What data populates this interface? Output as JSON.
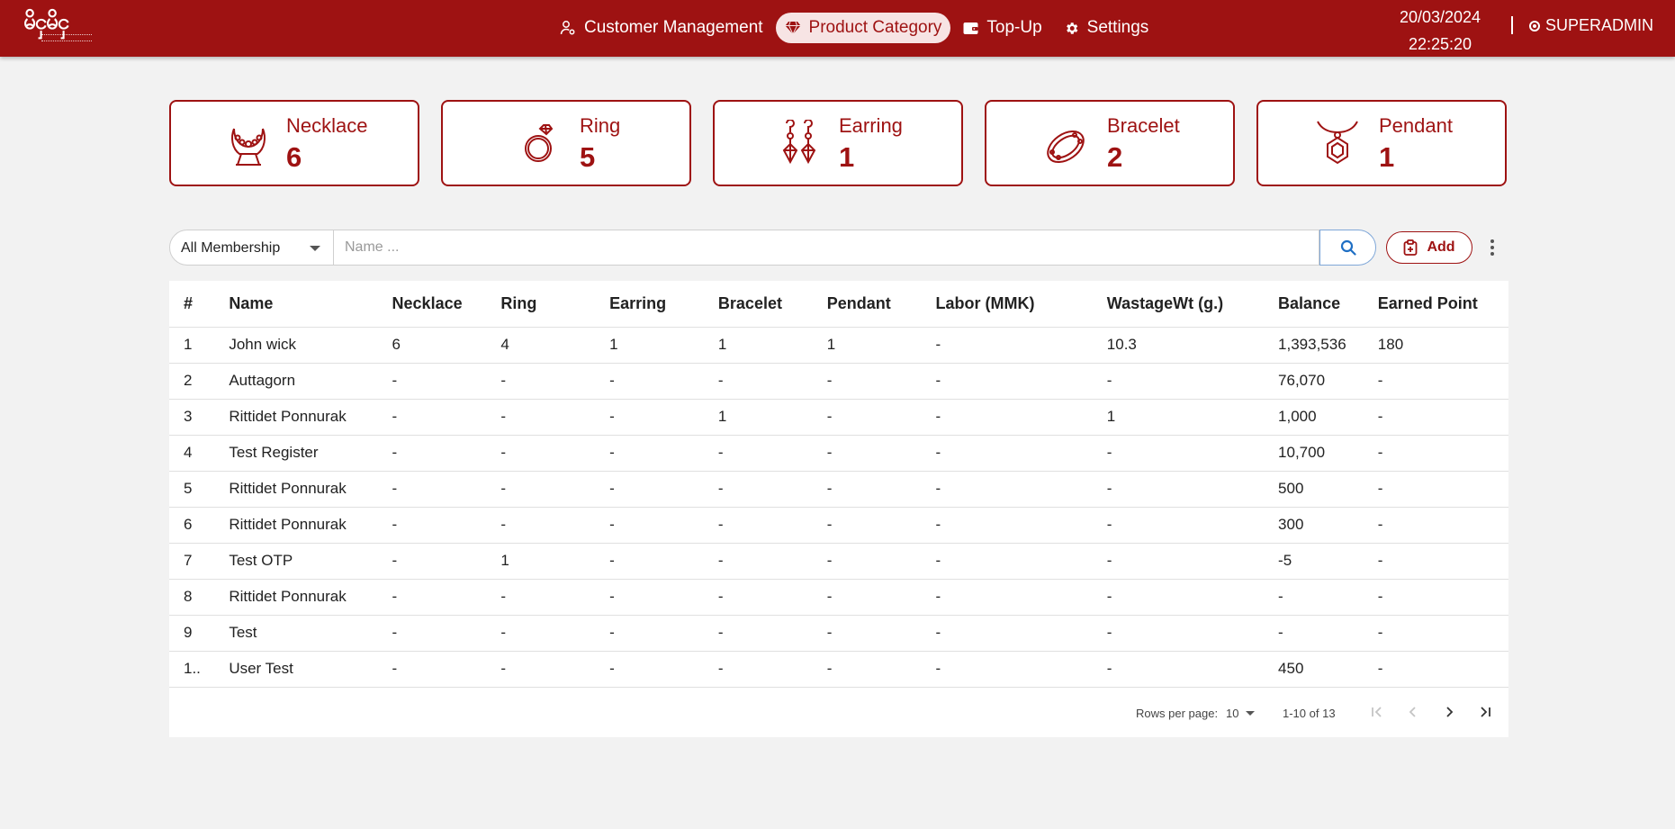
{
  "header": {
    "logo_text": "မိငှမိငှ",
    "nav": [
      {
        "label": "Customer Management",
        "icon": "user-gear-icon"
      },
      {
        "label": "Product Category",
        "icon": "diamond-icon",
        "active": true
      },
      {
        "label": "Top-Up",
        "icon": "wallet-icon"
      },
      {
        "label": "Settings",
        "icon": "gear-icon"
      }
    ],
    "date": "20/03/2024",
    "time": "22:25:20",
    "separator": "|",
    "user": "SUPERADMIN",
    "colors": {
      "brand": "#9e1212",
      "active_bg": "#f7e4e4"
    }
  },
  "categories": [
    {
      "label": "Necklace",
      "count": "6",
      "icon": "necklace-icon"
    },
    {
      "label": "Ring",
      "count": "5",
      "icon": "ring-icon"
    },
    {
      "label": "Earring",
      "count": "1",
      "icon": "earring-icon"
    },
    {
      "label": "Bracelet",
      "count": "2",
      "icon": "bracelet-icon"
    },
    {
      "label": "Pendant",
      "count": "1",
      "icon": "pendant-icon"
    }
  ],
  "filters": {
    "membership_selected": "All Membership",
    "name_placeholder": "Name ...",
    "add_label": "Add"
  },
  "table": {
    "columns": [
      "#",
      "Name",
      "Necklace",
      "Ring",
      "Earring",
      "Bracelet",
      "Pendant",
      "Labor (MMK)",
      "WastageWt (g.)",
      "Balance",
      "Earned Point"
    ],
    "rows": [
      [
        "1",
        "John wick",
        "6",
        "4",
        "1",
        "1",
        "1",
        "-",
        "10.3",
        "1,393,536",
        "180"
      ],
      [
        "2",
        "Auttagorn",
        "-",
        "-",
        "-",
        "-",
        "-",
        "-",
        "-",
        "76,070",
        "-"
      ],
      [
        "3",
        "Rittidet Ponnurak",
        "-",
        "-",
        "-",
        "1",
        "-",
        "-",
        "1",
        "1,000",
        "-"
      ],
      [
        "4",
        "Test Register",
        "-",
        "-",
        "-",
        "-",
        "-",
        "-",
        "-",
        "10,700",
        "-"
      ],
      [
        "5",
        "Rittidet Ponnurak",
        "-",
        "-",
        "-",
        "-",
        "-",
        "-",
        "-",
        "500",
        "-"
      ],
      [
        "6",
        "Rittidet Ponnurak",
        "-",
        "-",
        "-",
        "-",
        "-",
        "-",
        "-",
        "300",
        "-"
      ],
      [
        "7",
        "Test OTP",
        "-",
        "1",
        "-",
        "-",
        "-",
        "-",
        "-",
        "-5",
        "-"
      ],
      [
        "8",
        "Rittidet Ponnurak",
        "-",
        "-",
        "-",
        "-",
        "-",
        "-",
        "-",
        "-",
        "-"
      ],
      [
        "9",
        "Test",
        "-",
        "-",
        "-",
        "-",
        "-",
        "-",
        "-",
        "-",
        "-"
      ],
      [
        "1..",
        "User Test",
        "-",
        "-",
        "-",
        "-",
        "-",
        "-",
        "-",
        "450",
        "-"
      ]
    ]
  },
  "pagination": {
    "rows_per_page_label": "Rows per page:",
    "rows_per_page": "10",
    "range": "1-10 of 13"
  }
}
